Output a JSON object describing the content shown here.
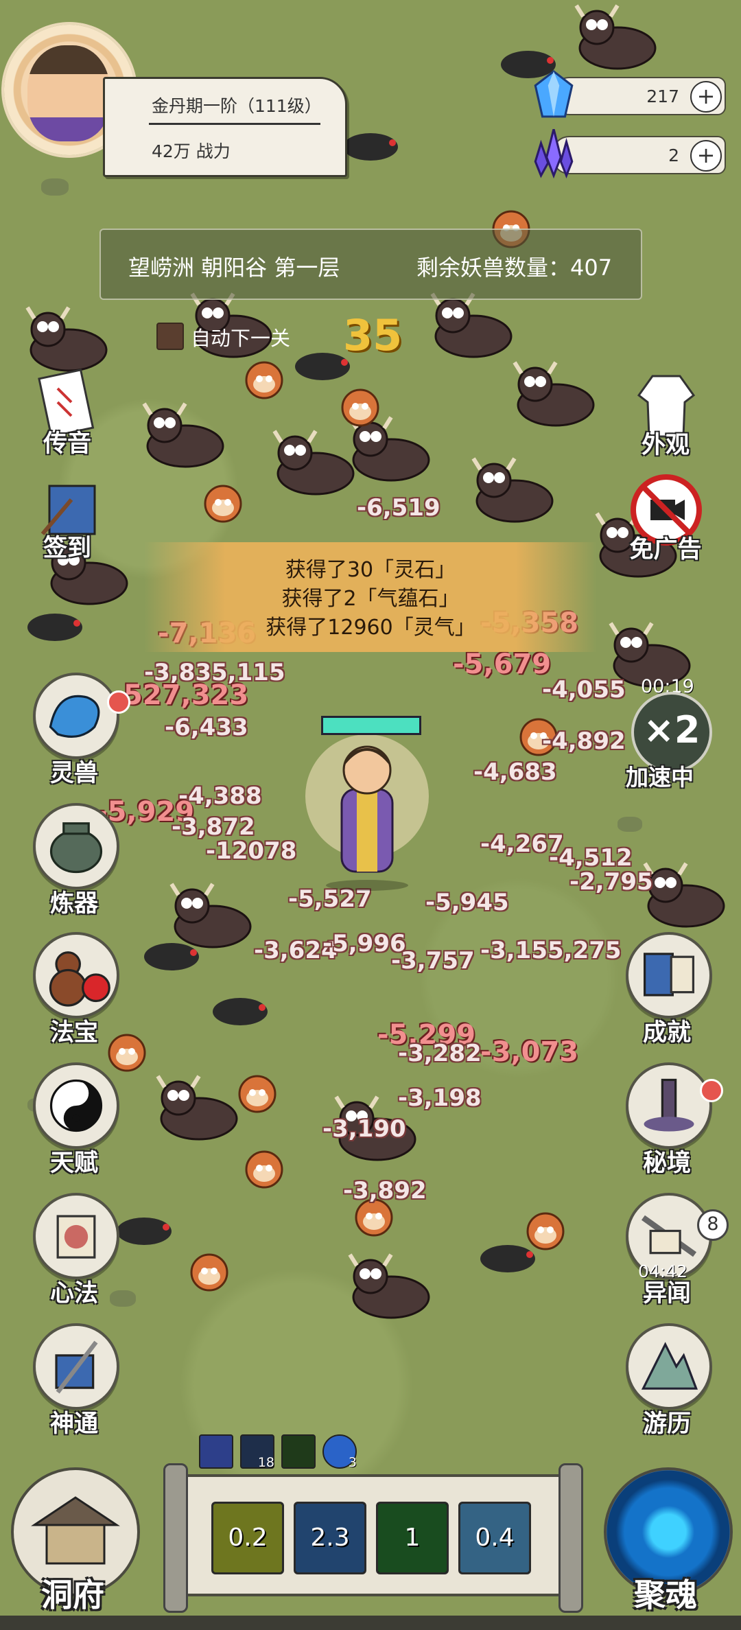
{
  "player": {
    "realm": "金丹期一阶（111级）",
    "power": "42万 战力"
  },
  "resources": [
    {
      "name": "spirit-crystal",
      "value": "217",
      "color": "#5bb7ff"
    },
    {
      "name": "qi-crystal",
      "value": "2",
      "color": "#7d5cff"
    }
  ],
  "stage": {
    "location": "望崂洲 朝阳谷 第一层",
    "remaining": "剩余妖兽数量：407"
  },
  "auto_next": "自动下一关",
  "wave_number": "35",
  "left_menu": [
    {
      "id": "message",
      "label": "传音"
    },
    {
      "id": "checkin",
      "label": "签到"
    },
    {
      "id": "beast",
      "label": "灵兽"
    },
    {
      "id": "refine",
      "label": "炼器"
    },
    {
      "id": "treasure",
      "label": "法宝"
    },
    {
      "id": "talent",
      "label": "天赋"
    },
    {
      "id": "mind",
      "label": "心法"
    },
    {
      "id": "divine",
      "label": "神通"
    }
  ],
  "right_menu": [
    {
      "id": "appearance",
      "label": "外观"
    },
    {
      "id": "no-ads",
      "label": "免广告"
    },
    {
      "id": "achievement",
      "label": "成就"
    },
    {
      "id": "secret-realm",
      "label": "秘境"
    },
    {
      "id": "rumors",
      "label": "异闻"
    },
    {
      "id": "travel",
      "label": "游历"
    }
  ],
  "speed": {
    "timer": "00:19",
    "multiplier": "×2",
    "label": "加速中"
  },
  "rumors_badge": "8",
  "rumors_timer": "04:42",
  "loot": [
    "获得了30「灵石」",
    "获得了2「气蕴石」",
    "获得了12960「灵气」"
  ],
  "damage_numbers": [
    "-6,519",
    "-7,136",
    "-5,358",
    "-3,835,115",
    "-5,679",
    "-4,055",
    "527,323",
    "-6,433",
    "-4,892",
    "-4,683",
    "-4,388",
    "-5,929",
    "-3,872",
    "-12078",
    "-4,267",
    "-4,512",
    "-2,795",
    "-5,527",
    "-5,945",
    "-3,624",
    "-5,996",
    "-3,757",
    "-3,155,275",
    "-5,299",
    "-3,282",
    "-3,073",
    "-3,198",
    "-3,190",
    "-3,892"
  ],
  "buffs": [
    {
      "id": "buff-1",
      "count": ""
    },
    {
      "id": "buff-2",
      "count": "18"
    },
    {
      "id": "buff-3",
      "count": ""
    },
    {
      "id": "buff-4",
      "count": "3"
    }
  ],
  "skills": [
    {
      "id": "skill-1",
      "cooldown": "0.2",
      "color": "#c8d83a"
    },
    {
      "id": "skill-2",
      "cooldown": "2.3",
      "color": "#3c7cc8"
    },
    {
      "id": "skill-3",
      "cooldown": "1",
      "color": "#2f8a3a"
    },
    {
      "id": "skill-4",
      "cooldown": "0.4",
      "color": "#5fb4f0"
    }
  ],
  "bottom_left": "洞府",
  "bottom_right": "聚魂"
}
